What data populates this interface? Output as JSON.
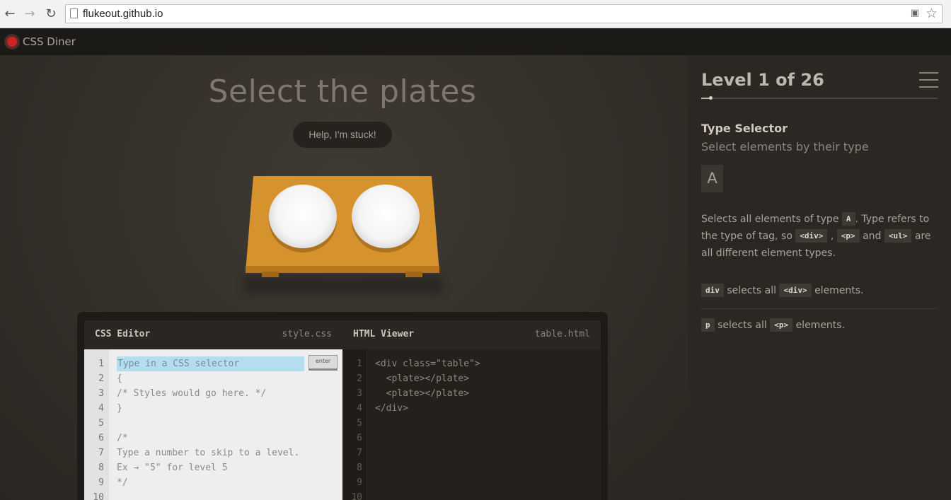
{
  "browser": {
    "url": "flukeout.github.io"
  },
  "app": {
    "title": "CSS Diner"
  },
  "main": {
    "instruction": "Select the plates",
    "help_label": "Help, I'm stuck!"
  },
  "css_editor": {
    "title": "CSS Editor",
    "filename": "style.css",
    "input_placeholder": "Type in a CSS selector",
    "enter_label": "enter",
    "line_numbers": [
      "1",
      "2",
      "3",
      "4",
      "5",
      "6",
      "7",
      "8",
      "9",
      "10"
    ],
    "lines": [
      "{",
      "/* Styles would go here. */",
      "}",
      "",
      "/*",
      "Type a number to skip to a level.",
      "Ex → \"5\" for level 5",
      "*/"
    ]
  },
  "html_viewer": {
    "title": "HTML Viewer",
    "filename": "table.html",
    "line_numbers": [
      "1",
      "2",
      "3",
      "4",
      "5",
      "6",
      "7",
      "8",
      "9",
      "10"
    ],
    "lines": [
      "<div class=\"table\">",
      "  <plate></plate>",
      "  <plate></plate>",
      "</div>"
    ]
  },
  "sidebar": {
    "level_indicator": "Level 1 of 26",
    "progress_fraction": 0.04,
    "selector_name": "Type Selector",
    "selector_title": "Select elements by their type",
    "syntax": "A",
    "hint": {
      "t1": "Selects all elements of type",
      "c1": "A",
      "t2": ". Type refers to the type of tag, so",
      "c2": "<div>",
      "t3": ",",
      "c3": "<p>",
      "t4": "and",
      "c4": "<ul>",
      "t5": "are all different element types."
    },
    "examples": [
      {
        "code": "div",
        "text1": "selects all",
        "tag": "<div>",
        "text2": "elements."
      },
      {
        "code": "p",
        "text1": "selects all",
        "tag": "<p>",
        "text2": "elements."
      }
    ]
  }
}
